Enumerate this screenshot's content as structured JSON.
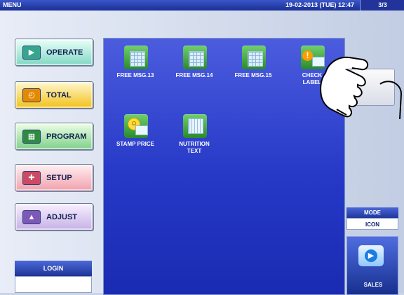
{
  "header": {
    "title": "MENU",
    "datetime": "19-02-2013 (TUE)  12:47",
    "page": "3/3"
  },
  "sidebar": {
    "buttons": [
      {
        "label": "OPERATE",
        "icon": "operate-icon"
      },
      {
        "label": "TOTAL",
        "icon": "clock-icon"
      },
      {
        "label": "PROGRAM",
        "icon": "book-icon"
      },
      {
        "label": "SETUP",
        "icon": "wrench-icon"
      },
      {
        "label": "ADJUST",
        "icon": "adjust-icon"
      }
    ],
    "login_label": "LOGIN",
    "login_value": ""
  },
  "main": {
    "items": [
      {
        "line1": "FREE MSG.13",
        "line2": ""
      },
      {
        "line1": "FREE MSG.14",
        "line2": ""
      },
      {
        "line1": "FREE MSG.15",
        "line2": ""
      },
      {
        "line1": "CHECK",
        "line2": "LABEL"
      },
      {
        "line1": "STAMP PRICE",
        "line2": ""
      },
      {
        "line1": "NUTRITION",
        "line2": "TEXT"
      }
    ]
  },
  "right": {
    "mode_label": "MODE",
    "mode_value": "ICON",
    "sales_label": "SALES"
  },
  "colors": {
    "panel": "#2538c6",
    "topbar": "#1a2f95",
    "accent": "#4b69d8"
  }
}
